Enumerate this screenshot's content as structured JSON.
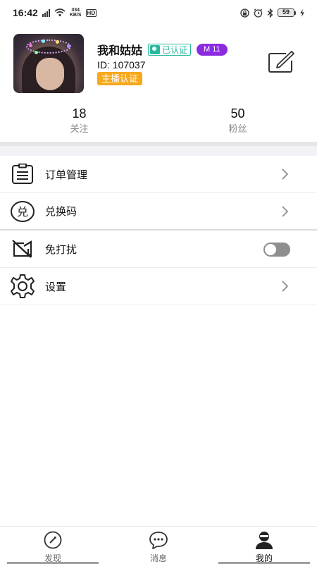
{
  "status_bar": {
    "time": "16:42",
    "network_speed_value": "334",
    "network_speed_unit": "KB/S",
    "hd_label": "HD",
    "battery": "59"
  },
  "profile": {
    "nickname": "我和姑姑",
    "verified_label": "已认证",
    "level": "M 11",
    "user_id": "ID: 107037",
    "anchor_badge": "主播认证"
  },
  "stats": [
    {
      "value": "18",
      "label": "关注"
    },
    {
      "value": "50",
      "label": "粉丝"
    }
  ],
  "menu": [
    {
      "label": "订单管理",
      "icon": "order-list-icon"
    },
    {
      "label": "兑换码",
      "icon": "redeem-code-icon"
    },
    {
      "label": "免打扰",
      "icon": "do-not-disturb-icon",
      "toggle_on": false
    },
    {
      "label": "设置",
      "icon": "gear-icon"
    }
  ],
  "bottom_nav": [
    {
      "label": "发现",
      "icon": "compass-icon",
      "active": false
    },
    {
      "label": "消息",
      "icon": "chat-bubble-icon",
      "active": false
    },
    {
      "label": "我的",
      "icon": "profile-icon",
      "active": true
    }
  ],
  "colors": {
    "verified": "#28b89a",
    "level_badge": "#8a2be2",
    "anchor_badge": "#f7a81b"
  }
}
